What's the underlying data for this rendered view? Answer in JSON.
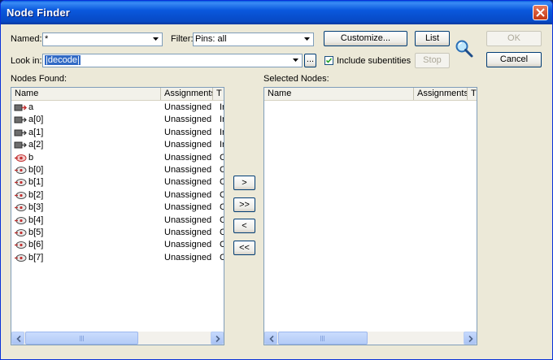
{
  "window": {
    "title": "Node Finder"
  },
  "form": {
    "named_label": "Named:",
    "named_value": "*",
    "filter_label": "Filter:",
    "filter_value": "Pins: all",
    "lookin_label": "Look in:",
    "lookin_value": "|decode|",
    "browse_label": "...",
    "include_subentities_label": "Include subentities",
    "include_subentities_checked": true
  },
  "buttons": {
    "customize": "Customize...",
    "list": "List",
    "stop": "Stop",
    "ok": "OK",
    "cancel": "Cancel"
  },
  "nodes_found": {
    "label": "Nodes Found:",
    "columns": [
      "Name",
      "Assignments",
      "T"
    ],
    "rows": [
      {
        "name": "a",
        "assignments": "Unassigned",
        "type": "Ir",
        "icon": "input-bus-pin-icon"
      },
      {
        "name": "a[0]",
        "assignments": "Unassigned",
        "type": "Ir",
        "icon": "input-pin-icon"
      },
      {
        "name": "a[1]",
        "assignments": "Unassigned",
        "type": "Ir",
        "icon": "input-pin-icon"
      },
      {
        "name": "a[2]",
        "assignments": "Unassigned",
        "type": "Ir",
        "icon": "input-pin-icon"
      },
      {
        "name": "b",
        "assignments": "Unassigned",
        "type": "C",
        "icon": "output-bus-pin-icon"
      },
      {
        "name": "b[0]",
        "assignments": "Unassigned",
        "type": "C",
        "icon": "output-pin-icon"
      },
      {
        "name": "b[1]",
        "assignments": "Unassigned",
        "type": "C",
        "icon": "output-pin-icon"
      },
      {
        "name": "b[2]",
        "assignments": "Unassigned",
        "type": "C",
        "icon": "output-pin-icon"
      },
      {
        "name": "b[3]",
        "assignments": "Unassigned",
        "type": "C",
        "icon": "output-pin-icon"
      },
      {
        "name": "b[4]",
        "assignments": "Unassigned",
        "type": "C",
        "icon": "output-pin-icon"
      },
      {
        "name": "b[5]",
        "assignments": "Unassigned",
        "type": "C",
        "icon": "output-pin-icon"
      },
      {
        "name": "b[6]",
        "assignments": "Unassigned",
        "type": "C",
        "icon": "output-pin-icon"
      },
      {
        "name": "b[7]",
        "assignments": "Unassigned",
        "type": "C",
        "icon": "output-pin-icon"
      }
    ]
  },
  "selected_nodes": {
    "label": "Selected Nodes:",
    "columns": [
      "Name",
      "Assignments",
      "T"
    ]
  },
  "transfer": {
    "add_one": ">",
    "add_all": ">>",
    "remove_one": "<",
    "remove_all": "<<"
  },
  "scrollbar": {
    "grip": "III"
  },
  "colors": {
    "titlebar": "#0a58dd",
    "input_pin": "#3b3b3b",
    "output_pin": "#c23131",
    "selection": "#316ac5"
  }
}
